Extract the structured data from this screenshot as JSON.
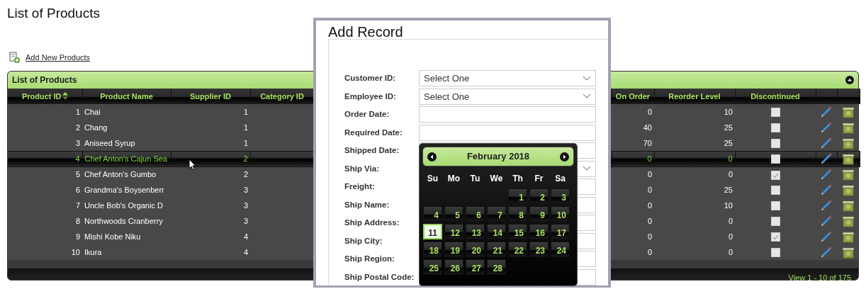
{
  "page_title": "List of Products",
  "add_link": {
    "label": "Add New Products"
  },
  "grid": {
    "caption": "List of Products",
    "columns": [
      {
        "label": "Product ID",
        "sorted": true
      },
      {
        "label": "Product Name",
        "sorted": false
      },
      {
        "label": "Supplier ID",
        "sorted": false
      },
      {
        "label": "Category ID",
        "sorted": false
      },
      {
        "label": "On Order",
        "sorted": false
      },
      {
        "label": "Reorder Level",
        "sorted": false
      },
      {
        "label": "Discontinued",
        "sorted": false
      }
    ],
    "rows": [
      {
        "product_id": "1",
        "product_name": "Chai",
        "supplier_id": "1",
        "on_order": "0",
        "reorder_level": "10",
        "discontinued": false,
        "selected": false
      },
      {
        "product_id": "2",
        "product_name": "Chang",
        "supplier_id": "1",
        "on_order": "40",
        "reorder_level": "25",
        "discontinued": false,
        "selected": false
      },
      {
        "product_id": "3",
        "product_name": "Aniseed Syrup",
        "supplier_id": "1",
        "on_order": "70",
        "reorder_level": "25",
        "discontinued": false,
        "selected": false
      },
      {
        "product_id": "4",
        "product_name": "Chef Anton's Cajun Sea",
        "supplier_id": "2",
        "on_order": "0",
        "reorder_level": "0",
        "discontinued": false,
        "selected": true
      },
      {
        "product_id": "5",
        "product_name": "Chef Anton's Gumbo",
        "supplier_id": "2",
        "on_order": "0",
        "reorder_level": "0",
        "discontinued": true,
        "selected": false
      },
      {
        "product_id": "6",
        "product_name": "Grandma's Boysenberr",
        "supplier_id": "3",
        "on_order": "0",
        "reorder_level": "25",
        "discontinued": false,
        "selected": false
      },
      {
        "product_id": "7",
        "product_name": "Uncle Bob's Organic D",
        "supplier_id": "3",
        "on_order": "0",
        "reorder_level": "10",
        "discontinued": false,
        "selected": false
      },
      {
        "product_id": "8",
        "product_name": "Northwoods Cranberry",
        "supplier_id": "3",
        "on_order": "0",
        "reorder_level": "0",
        "discontinued": false,
        "selected": false
      },
      {
        "product_id": "9",
        "product_name": "Mishi Kobe Niku",
        "supplier_id": "4",
        "on_order": "0",
        "reorder_level": "0",
        "discontinued": true,
        "selected": false
      },
      {
        "product_id": "10",
        "product_name": "Ikura",
        "supplier_id": "4",
        "on_order": "0",
        "reorder_level": "0",
        "discontinued": false,
        "selected": false
      }
    ],
    "pager": "View 1 - 10 of 175"
  },
  "dialog": {
    "title": "Add Record",
    "fields": [
      {
        "label": "Customer ID:",
        "kind": "select",
        "value": "Select One"
      },
      {
        "label": "Employee ID:",
        "kind": "select",
        "value": "Select One"
      },
      {
        "label": "Order Date:",
        "kind": "text"
      },
      {
        "label": "Required Date:",
        "kind": "text"
      },
      {
        "label": "Shipped Date:",
        "kind": "text"
      },
      {
        "label": "Ship Via:",
        "kind": "select"
      },
      {
        "label": "Freight:",
        "kind": "text"
      },
      {
        "label": "Ship Name:",
        "kind": "text"
      },
      {
        "label": "Ship Address:",
        "kind": "text"
      },
      {
        "label": "Ship City:",
        "kind": "text"
      },
      {
        "label": "Ship Region:",
        "kind": "text"
      },
      {
        "label": "Ship Postal Code:",
        "kind": "text"
      }
    ],
    "datepicker": {
      "month": "February 2018",
      "weekdays": [
        "Su",
        "Mo",
        "Tu",
        "We",
        "Th",
        "Fr",
        "Sa"
      ],
      "weeks": [
        [
          {
            "day": "1",
            "today": false
          },
          {
            "day": "2",
            "today": false
          },
          {
            "day": "3",
            "today": false
          }
        ],
        [
          {
            "day": "4",
            "today": false
          },
          {
            "day": "5",
            "today": false
          },
          {
            "day": "6",
            "today": false
          },
          {
            "day": "7",
            "today": false
          },
          {
            "day": "8",
            "today": false
          },
          {
            "day": "9",
            "today": false
          },
          {
            "day": "10",
            "today": false
          }
        ],
        [
          {
            "day": "11",
            "today": true
          },
          {
            "day": "12",
            "today": false
          },
          {
            "day": "13",
            "today": false
          },
          {
            "day": "14",
            "today": false
          },
          {
            "day": "15",
            "today": false
          },
          {
            "day": "16",
            "today": false
          },
          {
            "day": "17",
            "today": false
          }
        ],
        [
          {
            "day": "18",
            "today": false
          },
          {
            "day": "19",
            "today": false
          },
          {
            "day": "20",
            "today": false
          },
          {
            "day": "21",
            "today": false
          },
          {
            "day": "22",
            "today": false
          },
          {
            "day": "23",
            "today": false
          },
          {
            "day": "24",
            "today": false
          }
        ],
        [
          {
            "day": "25",
            "today": false
          },
          {
            "day": "26",
            "today": false
          },
          {
            "day": "27",
            "today": false
          },
          {
            "day": "28",
            "today": false
          }
        ]
      ]
    }
  }
}
